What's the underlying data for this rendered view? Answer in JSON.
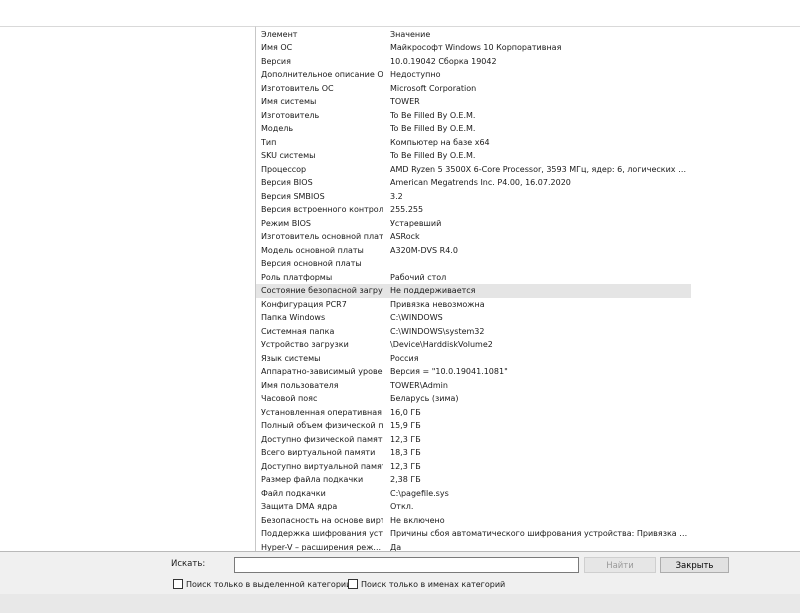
{
  "table": {
    "header": {
      "name": "Элемент",
      "value": "Значение"
    },
    "rows": [
      [
        "Имя ОС",
        "Майкрософт Windows 10 Корпоративная"
      ],
      [
        "Версия",
        "10.0.19042 Сборка 19042"
      ],
      [
        "Дополнительное описание ОС",
        "Недоступно"
      ],
      [
        "Изготовитель ОС",
        "Microsoft Corporation"
      ],
      [
        "Имя системы",
        "TOWER"
      ],
      [
        "Изготовитель",
        "To Be Filled By O.E.M."
      ],
      [
        "Модель",
        "To Be Filled By O.E.M."
      ],
      [
        "Тип",
        "Компьютер на базе x64"
      ],
      [
        "SKU системы",
        "To Be Filled By O.E.M."
      ],
      [
        "Процессор",
        "AMD Ryzen 5 3500X 6-Core Processor, 3593 МГц, ядер: 6, логических проце..."
      ],
      [
        "Версия BIOS",
        "American Megatrends Inc. P4.00, 16.07.2020"
      ],
      [
        "Версия SMBIOS",
        "3.2"
      ],
      [
        "Версия встроенного контролл...",
        "255.255"
      ],
      [
        "Режим BIOS",
        "Устаревший"
      ],
      [
        "Изготовитель основной платы",
        "ASRock"
      ],
      [
        "Модель основной платы",
        "A320M-DVS R4.0"
      ],
      [
        "Версия основной платы",
        ""
      ],
      [
        "Роль платформы",
        "Рабочий стол"
      ],
      [
        "Состояние безопасной загруз...",
        "Не поддерживается"
      ],
      [
        "Конфигурация PCR7",
        "Привязка невозможна"
      ],
      [
        "Папка Windows",
        "C:\\WINDOWS"
      ],
      [
        "Системная папка",
        "C:\\WINDOWS\\system32"
      ],
      [
        "Устройство загрузки",
        "\\Device\\HarddiskVolume2"
      ],
      [
        "Язык системы",
        "Россия"
      ],
      [
        "Аппаратно-зависимый уровен...",
        "Версия = \"10.0.19041.1081\""
      ],
      [
        "Имя пользователя",
        "TOWER\\Admin"
      ],
      [
        "Часовой пояс",
        "Беларусь (зима)"
      ],
      [
        "Установленная оперативная п...",
        "16,0 ГБ"
      ],
      [
        "Полный объем физической па...",
        "15,9 ГБ"
      ],
      [
        "Доступно физической памяти",
        "12,3 ГБ"
      ],
      [
        "Всего виртуальной памяти",
        "18,3 ГБ"
      ],
      [
        "Доступно виртуальной памяти",
        "12,3 ГБ"
      ],
      [
        "Размер файла подкачки",
        "2,38 ГБ"
      ],
      [
        "Файл подкачки",
        "C:\\pagefile.sys"
      ],
      [
        "Защита DMA ядра",
        "Откл."
      ],
      [
        "Безопасность на основе вирту...",
        "Не включено"
      ],
      [
        "Поддержка шифрования устр...",
        "Причины сбоя автоматического шифрования устройства: Привязка PCR7 н..."
      ],
      [
        "Hyper-V – расширения реж...",
        "Да"
      ]
    ],
    "selected_index": 18
  },
  "search": {
    "label": "Искать:",
    "value": "",
    "find_button": "Найти",
    "close_button": "Закрыть",
    "check_selected_category": "Поиск только в выделенной категории",
    "check_category_names": "Поиск только в именах категорий"
  }
}
